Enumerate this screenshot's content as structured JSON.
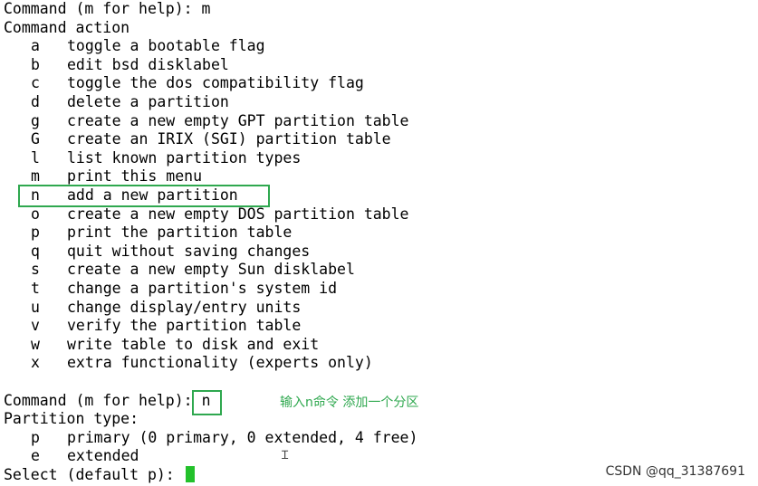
{
  "terminal": {
    "prompt1": "Command (m for help): m",
    "section_title": "Command action",
    "menu": [
      {
        "key": "a",
        "desc": "toggle a bootable flag"
      },
      {
        "key": "b",
        "desc": "edit bsd disklabel"
      },
      {
        "key": "c",
        "desc": "toggle the dos compatibility flag"
      },
      {
        "key": "d",
        "desc": "delete a partition"
      },
      {
        "key": "g",
        "desc": "create a new empty GPT partition table"
      },
      {
        "key": "G",
        "desc": "create an IRIX (SGI) partition table"
      },
      {
        "key": "l",
        "desc": "list known partition types"
      },
      {
        "key": "m",
        "desc": "print this menu"
      },
      {
        "key": "n",
        "desc": "add a new partition"
      },
      {
        "key": "o",
        "desc": "create a new empty DOS partition table"
      },
      {
        "key": "p",
        "desc": "print the partition table"
      },
      {
        "key": "q",
        "desc": "quit without saving changes"
      },
      {
        "key": "s",
        "desc": "create a new empty Sun disklabel"
      },
      {
        "key": "t",
        "desc": "change a partition's system id"
      },
      {
        "key": "u",
        "desc": "change display/entry units"
      },
      {
        "key": "v",
        "desc": "verify the partition table"
      },
      {
        "key": "w",
        "desc": "write table to disk and exit"
      },
      {
        "key": "x",
        "desc": "extra functionality (experts only)"
      }
    ],
    "prompt2_prefix": "Command (m for help):",
    "prompt2_input": "n",
    "partition_type_label": "Partition type:",
    "partition_options": [
      {
        "key": "p",
        "desc": "primary (0 primary, 0 extended, 4 free)"
      },
      {
        "key": "e",
        "desc": "extended"
      }
    ],
    "select_prompt": "Select (default p):"
  },
  "annotation": {
    "note": "输入n命令 添加一个分区",
    "color": "#2fa84f"
  },
  "watermark": "CSDN @qq_31387691"
}
